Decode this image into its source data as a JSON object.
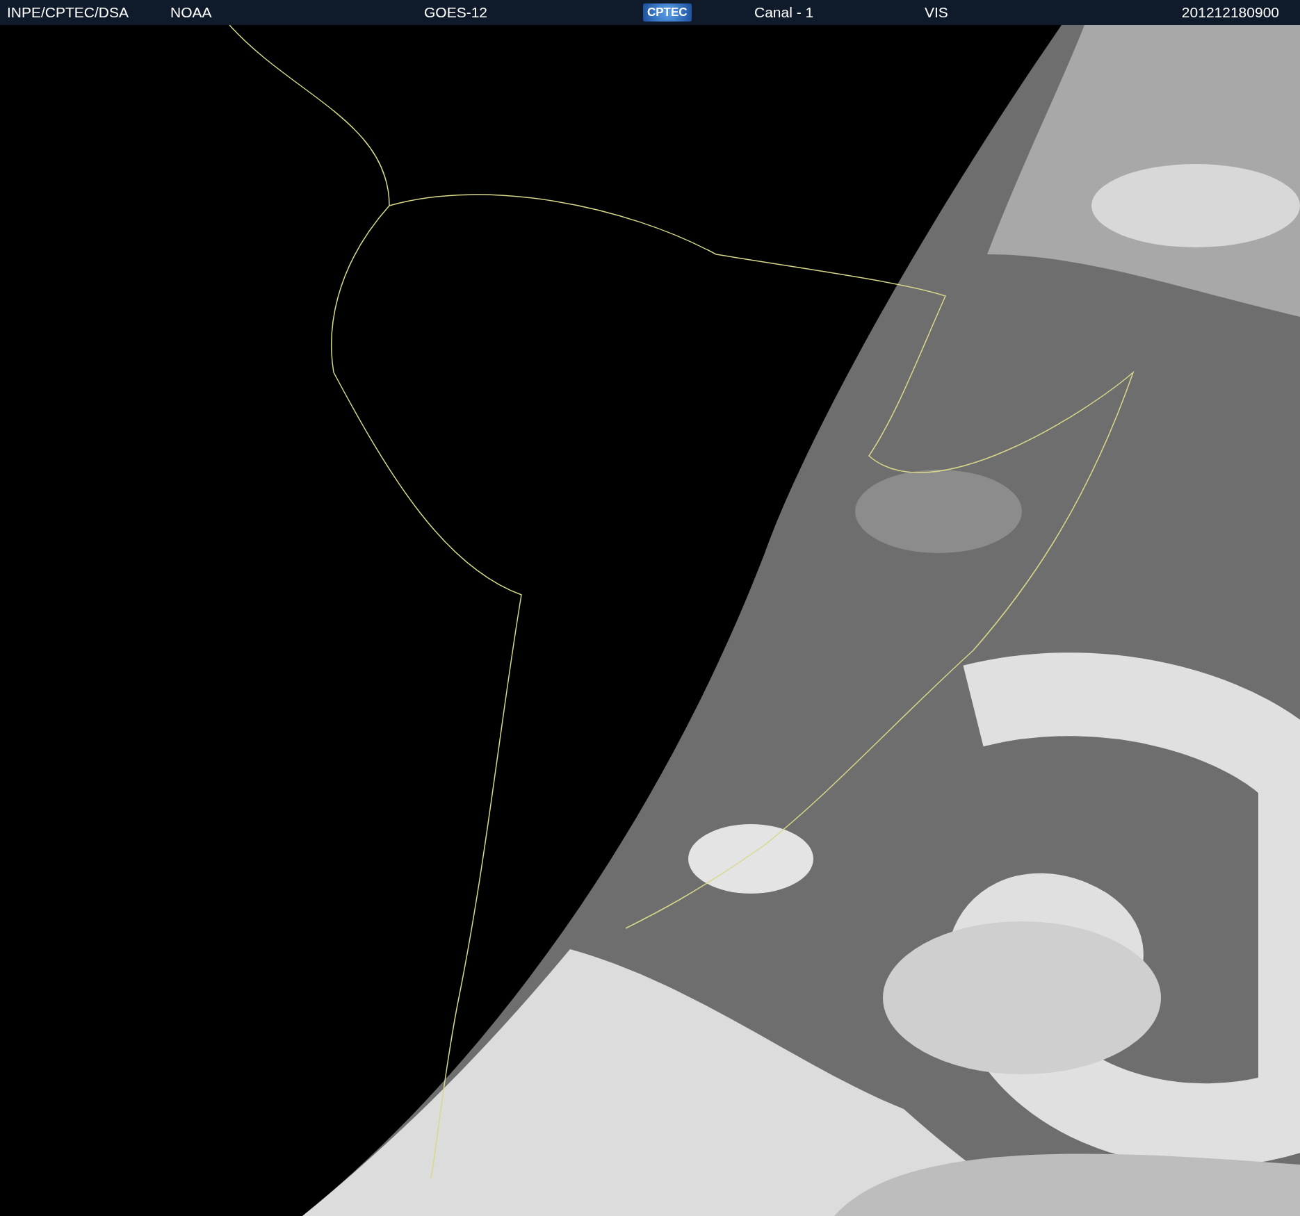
{
  "header": {
    "items": [
      {
        "kind": "text",
        "text": "INPE/CPTEC/DSA"
      },
      {
        "kind": "text",
        "text": "NOAA"
      },
      {
        "kind": "text",
        "text": "GOES-12"
      },
      {
        "kind": "logo",
        "text": "CPTEC"
      },
      {
        "kind": "text",
        "text": "Canal - 1"
      },
      {
        "kind": "text",
        "text": "VIS"
      },
      {
        "kind": "text",
        "text": "201212180900"
      }
    ]
  }
}
